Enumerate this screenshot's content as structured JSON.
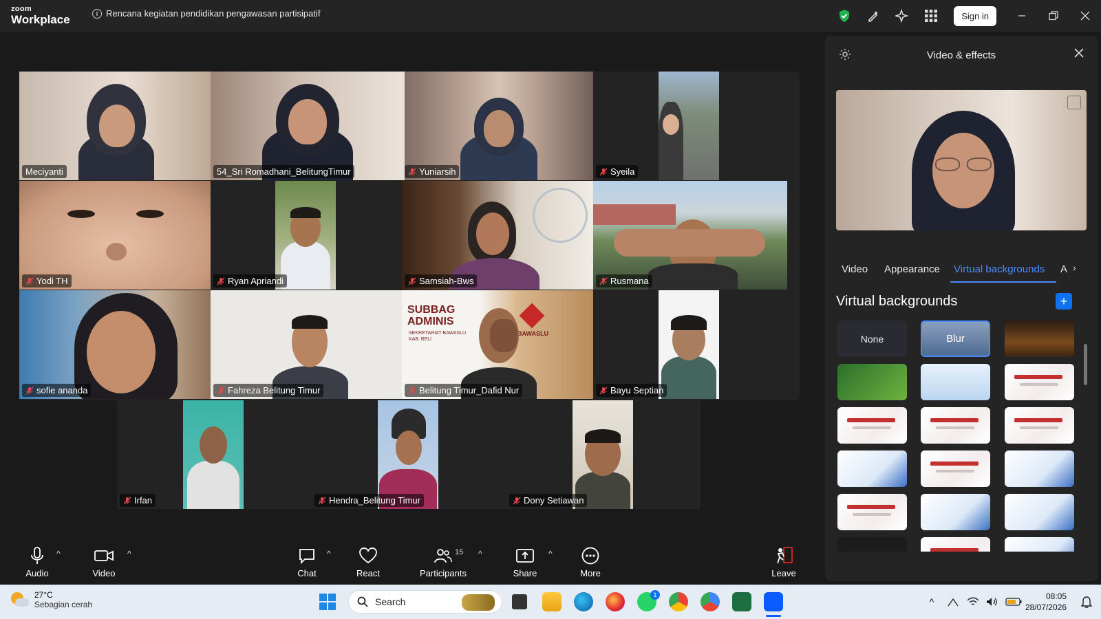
{
  "titlebar": {
    "brand_top": "zoom",
    "brand_bottom": "Workplace",
    "meeting_topic": "Rencana kegiatan pendidikan pengawasan partisipatif",
    "signin_label": "Sign in"
  },
  "participants": [
    {
      "name": "Meciyanti",
      "muted": false
    },
    {
      "name": "54_Sri Romadhani_BelitungTimur",
      "muted": false,
      "active": true
    },
    {
      "name": "Yuniarsih",
      "muted": true
    },
    {
      "name": "Syeila",
      "muted": true
    },
    {
      "name": "Yodi TH",
      "muted": true
    },
    {
      "name": "Ryan Apriandi",
      "muted": true
    },
    {
      "name": "Samsiah-Bws",
      "muted": true
    },
    {
      "name": "Rusmana",
      "muted": true
    },
    {
      "name": "sofie ananda",
      "muted": true
    },
    {
      "name": "Fahreza Belitung Timur",
      "muted": true
    },
    {
      "name": "Belitung Timur_Dafid Nur",
      "muted": true
    },
    {
      "name": "Bayu Septian",
      "muted": true
    },
    {
      "name": "Irfan",
      "muted": true
    },
    {
      "name": "Hendra_Belitung Timur",
      "muted": true
    },
    {
      "name": "Dony Setiawan",
      "muted": true
    }
  ],
  "tile_texts": {
    "bawaslu_sign": "SUBBAG ADMINIS",
    "bawaslu_sub": "SEKRETARIAT BAWASLU KAB. BELI",
    "bawaslu_logo": "BAWASLU"
  },
  "toolbar": {
    "audio": "Audio",
    "video": "Video",
    "chat": "Chat",
    "react": "React",
    "participants": "Participants",
    "participants_count": "15",
    "share": "Share",
    "more": "More",
    "leave": "Leave"
  },
  "panel": {
    "title": "Video & effects",
    "tabs": [
      "Video",
      "Appearance",
      "Virtual backgrounds",
      "A"
    ],
    "active_tab": "Virtual backgrounds",
    "section_title": "Virtual backgrounds",
    "none_label": "None",
    "blur_label": "Blur"
  },
  "taskbar": {
    "temperature": "27°C",
    "weather_desc": "Sebagian cerah",
    "search_placeholder": "Search",
    "whatsapp_badge": "1",
    "time": "08:05",
    "date": "28/07/2026"
  },
  "colors": {
    "accent_blue": "#0e72ed",
    "active_speaker": "#3ddc84",
    "mute_red": "#e5484d",
    "leave_red": "#e02828"
  }
}
